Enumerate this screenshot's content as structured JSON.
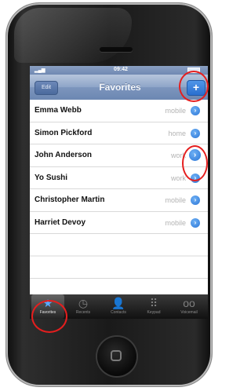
{
  "status_bar": {
    "time": "09:42"
  },
  "nav": {
    "edit_label": "Edit",
    "title": "Favorites",
    "add_label": "+"
  },
  "favorites": [
    {
      "name": "Emma Webb",
      "type": "mobile"
    },
    {
      "name": "Simon Pickford",
      "type": "home"
    },
    {
      "name": "John Anderson",
      "type": "work"
    },
    {
      "name": "Yo Sushi",
      "type": "work"
    },
    {
      "name": "Christopher Martin",
      "type": "mobile"
    },
    {
      "name": "Harriet Devoy",
      "type": "mobile"
    }
  ],
  "detail_glyph": "›",
  "tabs": [
    {
      "label": "Favorites",
      "icon": "star-icon",
      "glyph": "★",
      "active": true
    },
    {
      "label": "Recents",
      "icon": "clock-icon",
      "glyph": "◷",
      "active": false
    },
    {
      "label": "Contacts",
      "icon": "person-icon",
      "glyph": "👤",
      "active": false
    },
    {
      "label": "Keypad",
      "icon": "keypad-icon",
      "glyph": "⠿",
      "active": false
    },
    {
      "label": "Voicemail",
      "icon": "voicemail-icon",
      "glyph": "oo",
      "active": false
    }
  ],
  "colors": {
    "annotation": "#e51e1e",
    "accent": "#2a75d6"
  }
}
